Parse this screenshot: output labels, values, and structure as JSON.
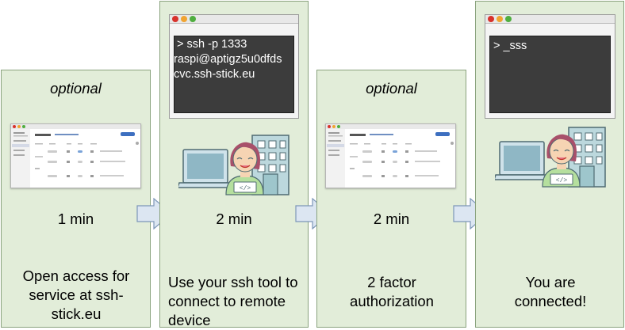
{
  "panels": [
    {
      "top_text": "optional",
      "time": "1 min",
      "bottom_text": "Open access for service at ssh-stick.eu"
    },
    {
      "top_text": "",
      "time": "2 min",
      "bottom_text": "Use your ssh tool to connect to remote device"
    },
    {
      "top_text": "optional",
      "time": "2 min",
      "bottom_text": "2 factor authorization"
    },
    {
      "top_text": "",
      "time": "",
      "bottom_text": "You are connected!"
    }
  ],
  "terminal_1": {
    "lines": [
      " > ssh -p 1333",
      "raspi@aptigz5u0dfds",
      "cvc.ssh-stick.eu"
    ]
  },
  "terminal_2": {
    "lines": [
      "> _sss"
    ]
  },
  "colors": {
    "panel_bg": "#e2edd9",
    "panel_border": "#8aa37e",
    "arrow_fill": "#dce6f2",
    "arrow_stroke": "#7d97b8",
    "terminal_bg": "#3c3c3c",
    "dot_red": "#d8322c",
    "dot_orange": "#f0a431",
    "dot_green": "#4fae3f"
  },
  "icons": [
    "browser-window-icon",
    "terminal-window-icon",
    "laptop-icon",
    "office-building-icon",
    "developer-person-icon",
    "right-arrow-icon"
  ]
}
